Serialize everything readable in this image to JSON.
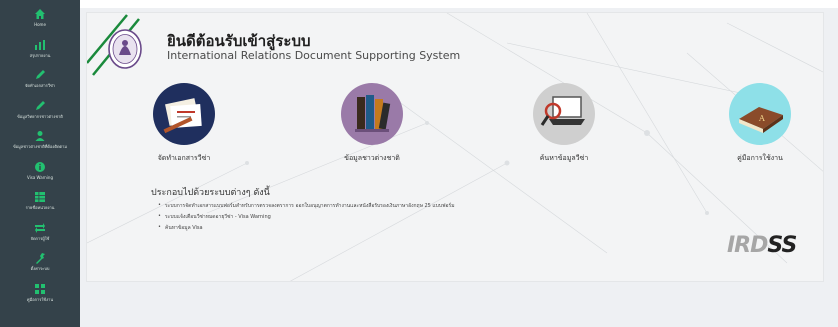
{
  "sidebar": {
    "bg_color": "#34424a",
    "icon_color": "#22c070",
    "items": [
      {
        "icon": "home-icon",
        "label": "Home"
      },
      {
        "icon": "bar-chart-icon",
        "label": "สรุปรายงาน"
      },
      {
        "icon": "pencil-icon",
        "label": "จัดทำเอกสารวีซ่า"
      },
      {
        "icon": "pencil-icon",
        "label": "ข้อมูลวิทยากรชาวต่างชาติ"
      },
      {
        "icon": "user-icon",
        "label": "ข้อมูลชาวต่างชาติที่ต้องติดตาม"
      },
      {
        "icon": "info-icon",
        "label": "Visa Warning"
      },
      {
        "icon": "table-icon",
        "label": "รายชื่อหน่วยงาน"
      },
      {
        "icon": "exchange-icon",
        "label": "จัดการผู้ใช้"
      },
      {
        "icon": "wrench-icon",
        "label": "ตั้งค่าระบบ"
      },
      {
        "icon": "grid-icon",
        "label": "คู่มือการใช้งาน"
      }
    ]
  },
  "header": {
    "title_th": "ยินดีต้อนรับเข้าสู่ระบบ",
    "title_en": "International Relations Document Supporting System",
    "logo": "university-seal-icon"
  },
  "menu": [
    {
      "label": "จัดทำเอกสารวีซ่า",
      "icon": "documents-icon",
      "circle_color": "#1f2f5e"
    },
    {
      "label": "ข้อมูลชาวต่างชาติ",
      "icon": "binders-icon",
      "circle_color": "#9a7aa8"
    },
    {
      "label": "ค้นหาข้อมูลวีซ่า",
      "icon": "search-laptop-icon",
      "circle_color": "#cfcfcf"
    },
    {
      "label": "คู่มือการใช้งาน",
      "icon": "book-icon",
      "circle_color": "#8ee0e8"
    }
  ],
  "intro": {
    "heading": "ประกอบไปด้วยระบบต่างๆ ดังนี้",
    "bullets": [
      "ระบบการจัดทำเอกสารแบบฟอร์มสำหรับการตรวจลงตราการ ออกใบอนุญาตการทำงานและหนังสือรับรองเงินภาษาอังกฤษ 25 แบบฟอร์ม",
      "ระบบแจ้งเตือนวีซ่าหมดอายุวีซ่า - Visa Warning",
      "ค้นหาข้อมูล Visa"
    ]
  },
  "brand": {
    "text_dark": "IRD",
    "text_accent": "SS",
    "full": "IRDSS"
  }
}
